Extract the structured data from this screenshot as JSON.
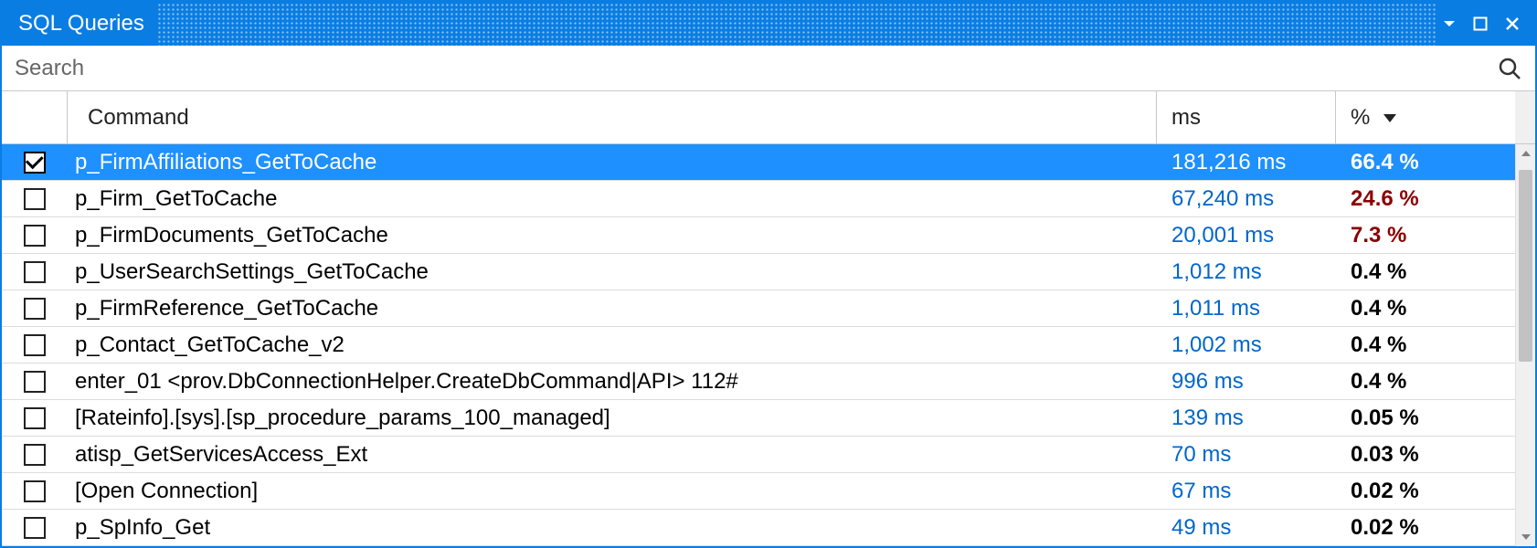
{
  "window": {
    "title": "SQL Queries"
  },
  "search": {
    "placeholder": "Search"
  },
  "columns": {
    "command": "Command",
    "ms": "ms",
    "pct": "%"
  },
  "sort": {
    "column": "pct",
    "direction": "desc"
  },
  "rows": [
    {
      "checked": true,
      "selected": true,
      "command": "p_FirmAffiliations_GetToCache",
      "ms": "181,216 ms",
      "pct": "66.4 %",
      "pct_high": false
    },
    {
      "checked": false,
      "selected": false,
      "command": "p_Firm_GetToCache",
      "ms": "67,240 ms",
      "pct": "24.6 %",
      "pct_high": true
    },
    {
      "checked": false,
      "selected": false,
      "command": "p_FirmDocuments_GetToCache",
      "ms": "20,001 ms",
      "pct": "7.3 %",
      "pct_high": true
    },
    {
      "checked": false,
      "selected": false,
      "command": "p_UserSearchSettings_GetToCache",
      "ms": "1,012 ms",
      "pct": "0.4 %",
      "pct_high": false
    },
    {
      "checked": false,
      "selected": false,
      "command": "p_FirmReference_GetToCache",
      "ms": "1,011 ms",
      "pct": "0.4 %",
      "pct_high": false
    },
    {
      "checked": false,
      "selected": false,
      "command": "p_Contact_GetToCache_v2",
      "ms": "1,002 ms",
      "pct": "0.4 %",
      "pct_high": false
    },
    {
      "checked": false,
      "selected": false,
      "command": "enter_01 <prov.DbConnectionHelper.CreateDbCommand|API> 112#",
      "ms": "996 ms",
      "pct": "0.4 %",
      "pct_high": false
    },
    {
      "checked": false,
      "selected": false,
      "command": "[Rateinfo].[sys].[sp_procedure_params_100_managed]",
      "ms": "139 ms",
      "pct": "0.05 %",
      "pct_high": false
    },
    {
      "checked": false,
      "selected": false,
      "command": "atisp_GetServicesAccess_Ext",
      "ms": "70 ms",
      "pct": "0.03 %",
      "pct_high": false
    },
    {
      "checked": false,
      "selected": false,
      "command": "[Open Connection]",
      "ms": "67 ms",
      "pct": "0.02 %",
      "pct_high": false
    },
    {
      "checked": false,
      "selected": false,
      "command": "p_SpInfo_Get",
      "ms": "49 ms",
      "pct": "0.02 %",
      "pct_high": false
    }
  ]
}
